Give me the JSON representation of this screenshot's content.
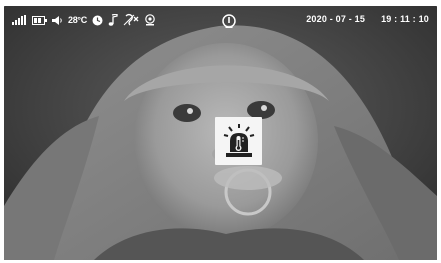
{
  "status_bar": {
    "temperature": "28°C",
    "date": "2020 - 07 - 15",
    "time": "19 : 11 : 10",
    "icons": [
      "signal-strength-icon",
      "battery-icon",
      "speaker-volume-icon",
      "clock-timer-icon",
      "music-note-icon",
      "sound-muted-icon",
      "camera-icon",
      "info-icon"
    ]
  },
  "alert": {
    "icon": "temperature-alert-icon"
  },
  "colors": {
    "overlay_text": "#ffffff",
    "alert_background": "#f5f5f5",
    "icon_dark": "#222222"
  }
}
